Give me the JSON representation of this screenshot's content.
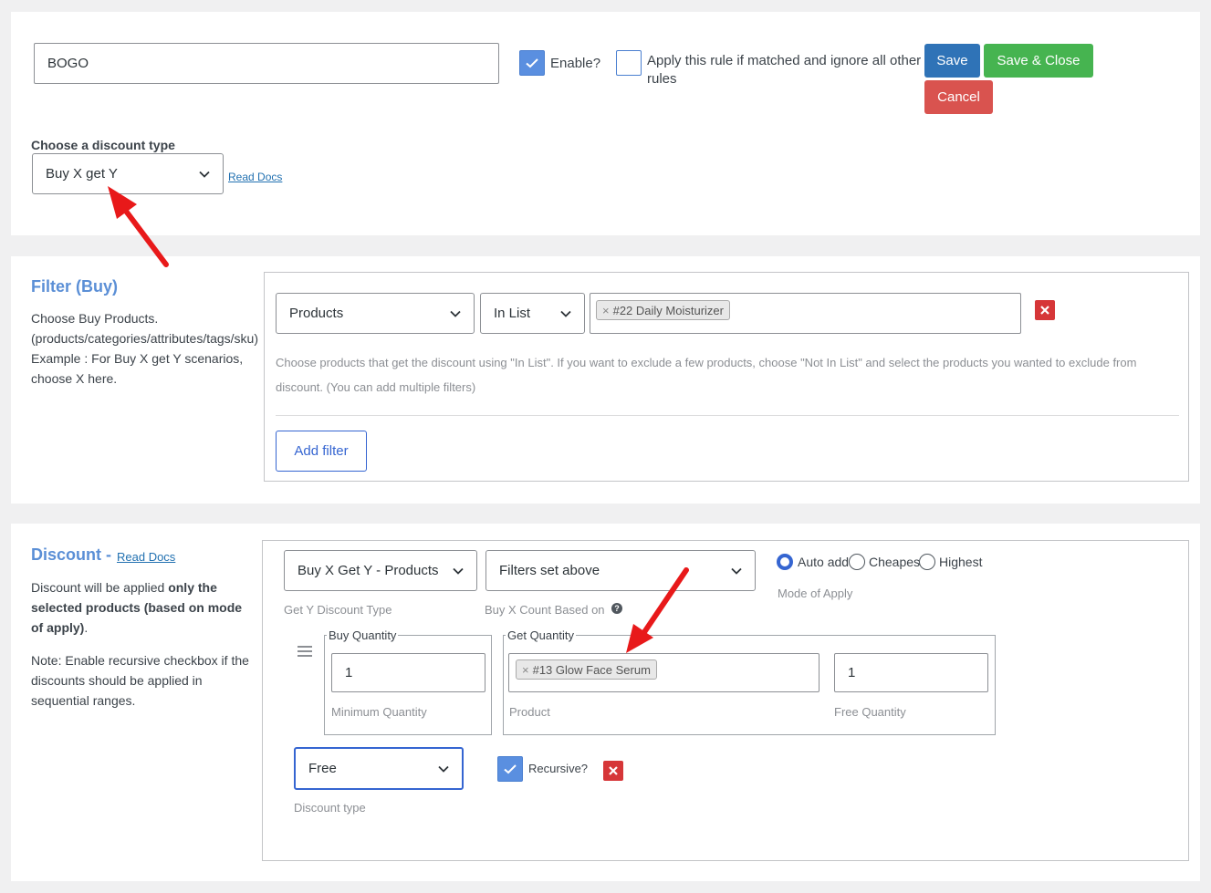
{
  "rule": {
    "name_value": "BOGO",
    "enable_label": "Enable?",
    "exclusive_label": "Apply this rule if matched and ignore all other rules",
    "save_label": "Save",
    "save_close_label": "Save & Close",
    "cancel_label": "Cancel",
    "discount_type_label": "Choose a discount type",
    "discount_type_value": "Buy X get Y",
    "read_docs_label": "Read Docs"
  },
  "filter": {
    "title": "Filter (Buy)",
    "desc_line1": "Choose Buy Products.",
    "desc_line2": "(products/categories/attributes/tags/sku)",
    "desc_line3": "Example : For Buy X get Y scenarios,",
    "desc_line4": "choose X here.",
    "type_value": "Products",
    "method_value": "In List",
    "product_tag": "#22 Daily Moisturizer",
    "help_text": "Choose products that get the discount using \"In List\". If you want to exclude a few products, choose \"Not In List\" and select the products you wanted to exclude from discount. (You can add multiple filters)",
    "add_filter_label": "Add filter"
  },
  "discount": {
    "title": "Discount -",
    "read_docs_label": "Read Docs",
    "desc_prefix": "Discount will be applied ",
    "desc_bold": "only the selected products (based on mode of apply)",
    "desc_suffix": ".",
    "note": "Note: Enable recursive checkbox if the discounts should be applied in sequential ranges.",
    "get_y_type_value": "Buy X Get Y - Products",
    "get_y_type_label": "Get Y Discount Type",
    "count_based_value": "Filters set above",
    "count_based_label": "Buy X Count Based on",
    "mode_options": [
      "Auto add",
      "Cheapest",
      "Highest"
    ],
    "mode_selected": "Auto add",
    "mode_label": "Mode of Apply",
    "buy_quantity_legend": "Buy Quantity",
    "buy_quantity_value": "1",
    "buy_quantity_help": "Minimum Quantity",
    "get_quantity_legend": "Get Quantity",
    "get_product_tag": "#13 Glow Face Serum",
    "get_product_help": "Product",
    "free_quantity_value": "1",
    "free_quantity_help": "Free Quantity",
    "discount_type_value": "Free",
    "discount_type_help": "Discount type",
    "recursive_label": "Recursive?"
  },
  "colors": {
    "save": "#2f73b7",
    "save_close": "#46b450",
    "cancel": "#d9534f",
    "accent": "#5b8fd6",
    "annotation_arrow": "#e8191a"
  }
}
